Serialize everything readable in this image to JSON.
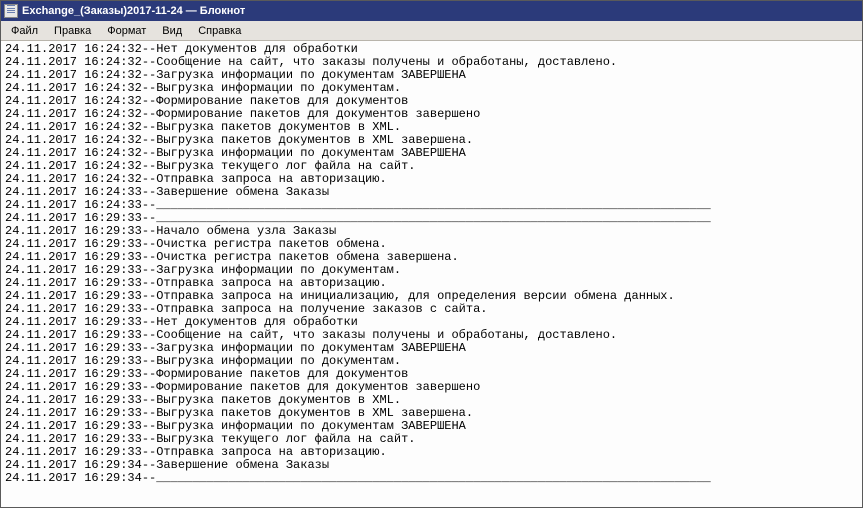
{
  "window": {
    "title": "Exchange_(Заказы)2017-11-24 — Блокнот"
  },
  "menu": {
    "file": "Файл",
    "edit": "Правка",
    "format": "Формат",
    "view": "Вид",
    "help": "Справка"
  },
  "log": {
    "lines": [
      "24.11.2017 16:24:32--Нет документов для обработки",
      "24.11.2017 16:24:32--Сообщение на сайт, что заказы получены и обработаны, доставлено.",
      "24.11.2017 16:24:32--Загрузка информации по документам ЗАВЕРШЕНА",
      "24.11.2017 16:24:32--Выгрузка информации по документам.",
      "24.11.2017 16:24:32--Формирование пакетов для документов",
      "24.11.2017 16:24:32--Формирование пакетов для документов завершено",
      "24.11.2017 16:24:32--Выгрузка пакетов документов в XML.",
      "24.11.2017 16:24:32--Выгрузка пакетов документов в XML завершена.",
      "24.11.2017 16:24:32--Выгрузка информации по документам ЗАВЕРШЕНА",
      "24.11.2017 16:24:32--Выгрузка текущего лог файла на сайт.",
      "24.11.2017 16:24:32--Отправка запроса на авторизацию.",
      "24.11.2017 16:24:33--Завершение обмена Заказы",
      "24.11.2017 16:24:33--_____________________________________________________________________________",
      "24.11.2017 16:29:33--_____________________________________________________________________________",
      "24.11.2017 16:29:33--Начало обмена узла Заказы",
      "24.11.2017 16:29:33--Очистка регистра пакетов обмена.",
      "24.11.2017 16:29:33--Очистка регистра пакетов обмена завершена.",
      "24.11.2017 16:29:33--Загрузка информации по документам.",
      "24.11.2017 16:29:33--Отправка запроса на авторизацию.",
      "24.11.2017 16:29:33--Отправка запроса на инициализацию, для определения версии обмена данных.",
      "24.11.2017 16:29:33--Отправка запроса на получение заказов с сайта.",
      "24.11.2017 16:29:33--Нет документов для обработки",
      "24.11.2017 16:29:33--Сообщение на сайт, что заказы получены и обработаны, доставлено.",
      "24.11.2017 16:29:33--Загрузка информации по документам ЗАВЕРШЕНА",
      "24.11.2017 16:29:33--Выгрузка информации по документам.",
      "24.11.2017 16:29:33--Формирование пакетов для документов",
      "24.11.2017 16:29:33--Формирование пакетов для документов завершено",
      "24.11.2017 16:29:33--Выгрузка пакетов документов в XML.",
      "24.11.2017 16:29:33--Выгрузка пакетов документов в XML завершена.",
      "24.11.2017 16:29:33--Выгрузка информации по документам ЗАВЕРШЕНА",
      "24.11.2017 16:29:33--Выгрузка текущего лог файла на сайт.",
      "24.11.2017 16:29:33--Отправка запроса на авторизацию.",
      "24.11.2017 16:29:34--Завершение обмена Заказы",
      "24.11.2017 16:29:34--_____________________________________________________________________________"
    ]
  }
}
